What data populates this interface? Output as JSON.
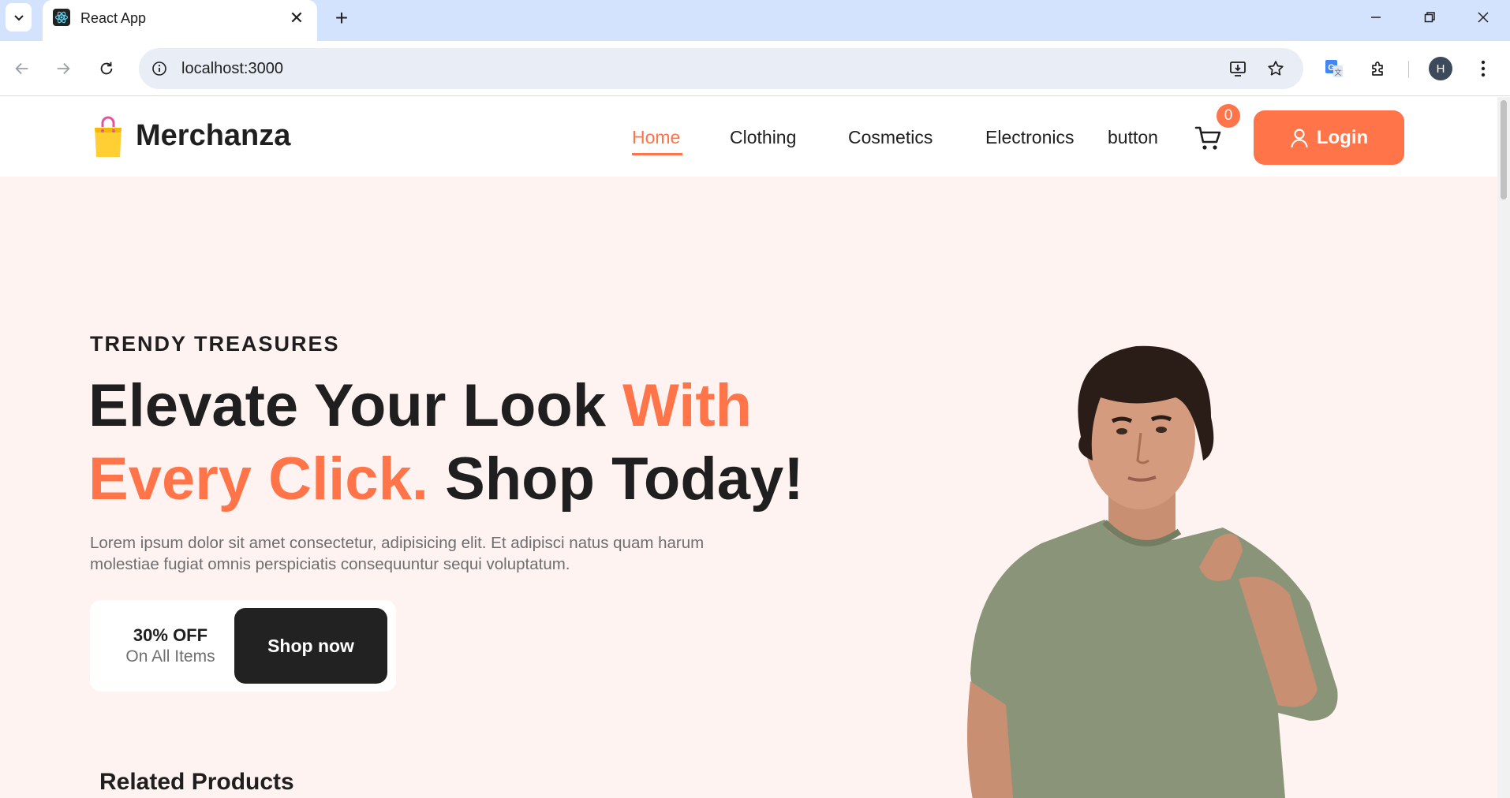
{
  "browser": {
    "tab_title": "React App",
    "url": "localhost:3000",
    "profile_initial": "H"
  },
  "site": {
    "brand": "Merchanza",
    "nav": [
      {
        "label": "Home",
        "active": true
      },
      {
        "label": "Clothing"
      },
      {
        "label": "Cosmetics"
      },
      {
        "label": "Electronics"
      },
      {
        "label": "button"
      }
    ],
    "cart_count": "0",
    "login_label": "Login",
    "colors": {
      "accent": "#ff7448",
      "hero_bg": "#fff3f1",
      "dark": "#222222"
    }
  },
  "hero": {
    "eyebrow": "TRENDY TREASURES",
    "headline_part1": "Elevate Your Look ",
    "headline_accent": "With Every Click.",
    "headline_part2": " Shop Today!",
    "description": "Lorem ipsum dolor sit amet consectetur, adipisicing elit. Et adipisci natus quam harum molestiae fugiat omnis perspiciatis consequuntur sequi voluptatum.",
    "promo_title": "30% OFF",
    "promo_subtitle": "On All Items",
    "cta_label": "Shop now"
  },
  "related_title": "Related Products"
}
